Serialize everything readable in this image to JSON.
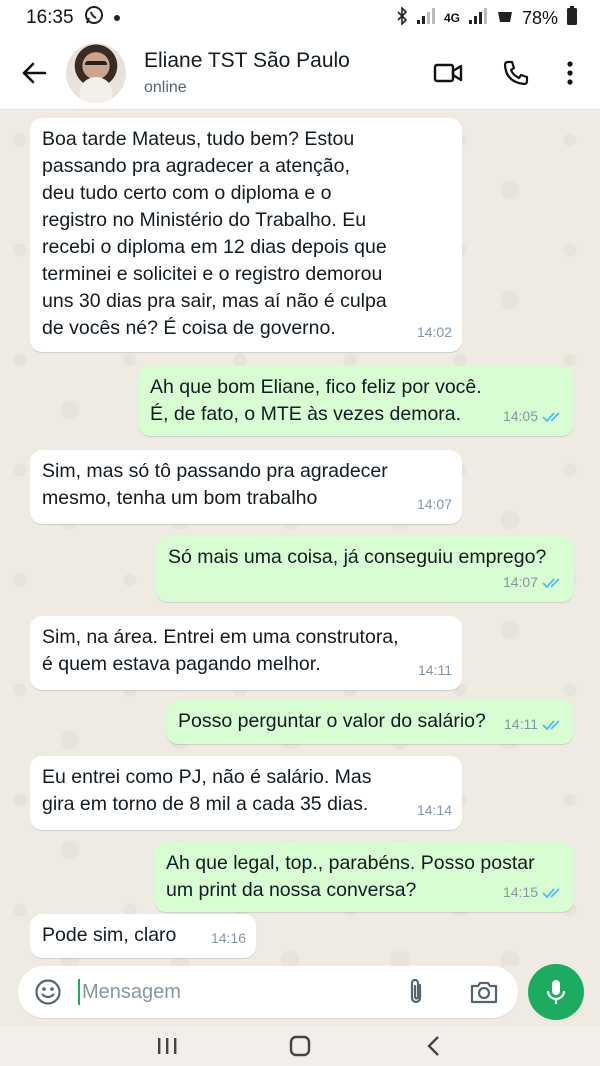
{
  "status_bar": {
    "time": "16:35",
    "network": "4G",
    "battery": "78%"
  },
  "header": {
    "contact_name": "Eliane TST São Paulo",
    "contact_status": "online"
  },
  "messages": [
    {
      "direction": "in",
      "text": "Boa tarde Mateus, tudo bem? Estou\npassando pra agradecer a atenção,\ndeu tudo certo com o diploma e o\nregistro no Ministério do Trabalho. Eu\nrecebi o diploma em 12 dias depois que\nterminei e solicitei e o registro demorou\nuns 30 dias pra sair, mas aí não é culpa\nde vocês né? É coisa de governo.",
      "time": "14:02"
    },
    {
      "direction": "out",
      "text": "Ah que bom Eliane, fico feliz por você.\nÉ, de fato, o MTE às vezes demora.",
      "time": "14:05",
      "read": true
    },
    {
      "direction": "in",
      "text": "Sim, mas só tô passando pra agradecer\nmesmo, tenha um bom trabalho",
      "time": "14:07"
    },
    {
      "direction": "out",
      "text": "Só mais uma coisa, já conseguiu emprego?",
      "time": "14:07",
      "read": true
    },
    {
      "direction": "in",
      "text": "Sim, na área. Entrei em uma construtora,\né quem estava pagando melhor.",
      "time": "14:11"
    },
    {
      "direction": "out",
      "text": "Posso perguntar o valor do salário?",
      "time": "14:11",
      "read": true
    },
    {
      "direction": "in",
      "text": "Eu entrei como PJ, não é salário. Mas\ngira em torno de 8 mil a cada 35 dias.",
      "time": "14:14"
    },
    {
      "direction": "out",
      "text": "Ah que legal, top., parabéns. Posso postar\num print da nossa conversa?",
      "time": "14:15",
      "read": true
    },
    {
      "direction": "in",
      "text": "Pode sim, claro",
      "time": "14:16"
    }
  ],
  "input": {
    "placeholder": "Mensagem"
  },
  "colors": {
    "accent": "#1daa61",
    "outgoing_bubble": "#d9fdd3",
    "incoming_bubble": "#ffffff",
    "read_ticks": "#53bdeb",
    "chat_background": "#efeae2"
  },
  "icons": {
    "back": "arrow-left-icon",
    "video": "video-camera-icon",
    "call": "phone-icon",
    "menu": "more-vertical-icon",
    "emoji": "emoji-icon",
    "attach": "paperclip-icon",
    "camera": "camera-icon",
    "mic": "microphone-icon"
  }
}
